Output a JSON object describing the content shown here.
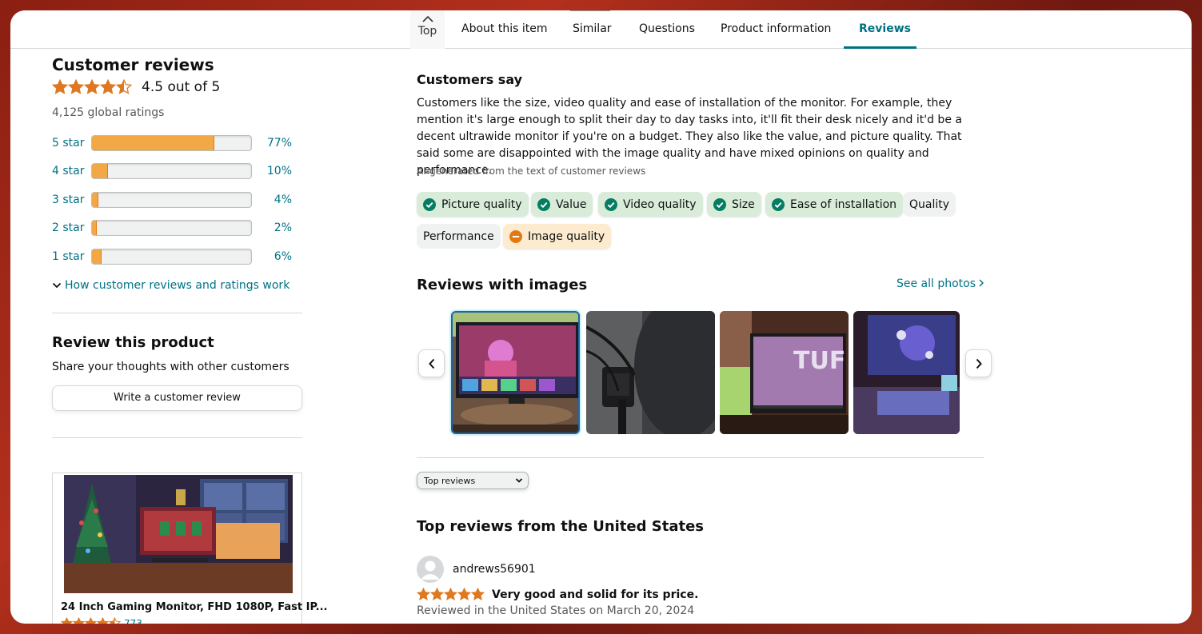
{
  "nav": {
    "top_label": "Top",
    "items": [
      "About this item",
      "Similar",
      "Questions",
      "Product information",
      "Reviews"
    ]
  },
  "reviews_summary": {
    "title": "Customer reviews",
    "rating_text": "4.5 out of 5",
    "rating_value": 4.5,
    "global_ratings": "4,125 global ratings",
    "histogram": [
      {
        "label": "5 star",
        "pct": "77%",
        "value": 77
      },
      {
        "label": "4 star",
        "pct": "10%",
        "value": 10
      },
      {
        "label": "3 star",
        "pct": "4%",
        "value": 4
      },
      {
        "label": "2 star",
        "pct": "2%",
        "value": 2
      },
      {
        "label": "1 star",
        "pct": "6%",
        "value": 6
      }
    ],
    "how_link": "How customer reviews and ratings work"
  },
  "review_product": {
    "title": "Review this product",
    "subtitle": "Share your thoughts with other customers",
    "button": "Write a customer review"
  },
  "ad": {
    "title": "24 Inch Gaming Monitor, FHD 1080P, Fast IP...",
    "rating_value": 4.5,
    "count": "773"
  },
  "customers_say": {
    "title": "Customers say",
    "body": "Customers like the size, video quality and ease of installation of the monitor. For example, they mention it's large enough to split their day to day tasks into, it'll fit their desk nicely and it'd be a decent ultrawide monitor if you're on a budget. They also like the value, and picture quality. That said some are disappointed with the image quality and have mixed opinions on quality and performance.",
    "ai_note": "AI-generated from the text of customer reviews",
    "chips": [
      {
        "label": "Picture quality",
        "sentiment": "positive"
      },
      {
        "label": "Value",
        "sentiment": "positive"
      },
      {
        "label": "Video quality",
        "sentiment": "positive"
      },
      {
        "label": "Size",
        "sentiment": "positive"
      },
      {
        "label": "Ease of installation",
        "sentiment": "positive"
      },
      {
        "label": "Quality",
        "sentiment": "neutral"
      },
      {
        "label": "Performance",
        "sentiment": "neutral"
      },
      {
        "label": "Image quality",
        "sentiment": "negative"
      }
    ]
  },
  "reviews_with_images": {
    "title": "Reviews with images",
    "see_all": "See all photos"
  },
  "sort": {
    "selected": "Top reviews"
  },
  "top_reviews": {
    "title": "Top reviews from the United States",
    "first": {
      "reviewer": "andrews56901",
      "rating_value": 5,
      "headline": "Very good and solid for its price.",
      "date": "Reviewed in the United States on March 20, 2024"
    }
  },
  "colors": {
    "link": "#007185",
    "star": "#de7921",
    "bar": "#f3a847",
    "positive_chip": "#d8ecd9",
    "positive_icon": "#067d62",
    "negative_icon": "#e47911"
  }
}
